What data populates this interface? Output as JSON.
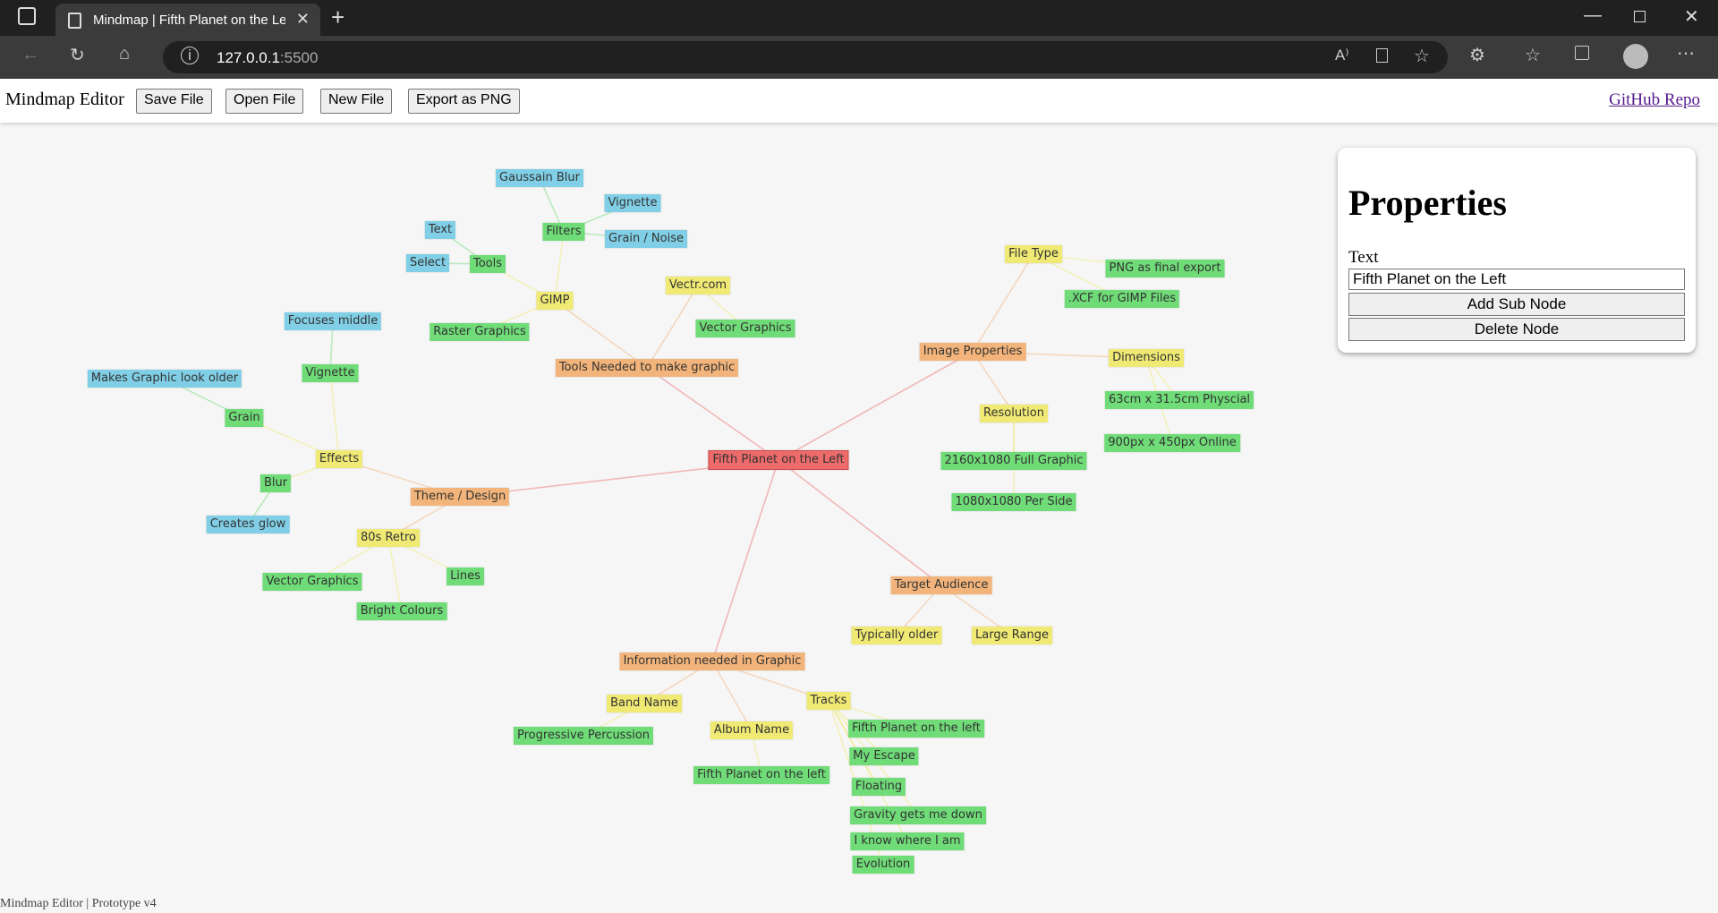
{
  "browser": {
    "tab_title": "Mindmap | Fifth Planet on the Left",
    "url_host": "127.0.0.1",
    "url_port": ":5500"
  },
  "toolbar": {
    "app_title": "Mindmap Editor",
    "save_label": "Save File",
    "open_label": "Open File",
    "new_label": "New File",
    "export_label": "Export as PNG",
    "github_label": "GitHub Repo"
  },
  "properties": {
    "heading": "Properties",
    "text_label": "Text",
    "text_value": "Fifth Planet on the Left",
    "add_label": "Add Sub Node",
    "delete_label": "Delete Node"
  },
  "footer": "Mindmap Editor | Prototype v4",
  "colors": {
    "root": "#ee6b6b",
    "level1": "#f2b47a",
    "level2": "#f0ea74",
    "level3": "#6fdc78",
    "level4": "#80cfe6"
  },
  "nodes": [
    {
      "id": "root",
      "label": "Fifth Planet on the Left",
      "level": 0,
      "parent": null
    },
    {
      "id": "tools",
      "label": "Tools Needed to make graphic",
      "level": 1,
      "parent": "root"
    },
    {
      "id": "gimp",
      "label": "GIMP",
      "level": 2,
      "parent": "tools"
    },
    {
      "id": "filters",
      "label": "Filters",
      "level": 3,
      "parent": "gimp"
    },
    {
      "id": "gauss",
      "label": "Gaussain Blur",
      "level": 4,
      "parent": "filters"
    },
    {
      "id": "vign1",
      "label": "Vignette",
      "level": 4,
      "parent": "filters"
    },
    {
      "id": "grain1",
      "label": "Grain / Noise",
      "level": 4,
      "parent": "filters"
    },
    {
      "id": "gtools",
      "label": "Tools",
      "level": 3,
      "parent": "gimp"
    },
    {
      "id": "text",
      "label": "Text",
      "level": 4,
      "parent": "gtools"
    },
    {
      "id": "select",
      "label": "Select",
      "level": 4,
      "parent": "gtools"
    },
    {
      "id": "raster",
      "label": "Raster Graphics",
      "level": 3,
      "parent": "gimp"
    },
    {
      "id": "vectr",
      "label": "Vectr.com",
      "level": 2,
      "parent": "tools"
    },
    {
      "id": "vecg1",
      "label": "Vector Graphics",
      "level": 3,
      "parent": "vectr"
    },
    {
      "id": "image",
      "label": "Image Properties",
      "level": 1,
      "parent": "root"
    },
    {
      "id": "ftype",
      "label": "File Type",
      "level": 2,
      "parent": "image"
    },
    {
      "id": "png",
      "label": "PNG as final export",
      "level": 3,
      "parent": "ftype"
    },
    {
      "id": "xcf",
      "label": ".XCF for GIMP Files",
      "level": 3,
      "parent": "ftype"
    },
    {
      "id": "dims",
      "label": "Dimensions",
      "level": 2,
      "parent": "image"
    },
    {
      "id": "d63",
      "label": "63cm x 31.5cm Physcial",
      "level": 3,
      "parent": "dims"
    },
    {
      "id": "d900",
      "label": "900px x 450px Online",
      "level": 3,
      "parent": "dims"
    },
    {
      "id": "res",
      "label": "Resolution",
      "level": 2,
      "parent": "image"
    },
    {
      "id": "r2160",
      "label": "2160x1080 Full Graphic",
      "level": 3,
      "parent": "res"
    },
    {
      "id": "r1080",
      "label": "1080x1080 Per Side",
      "level": 3,
      "parent": "res"
    },
    {
      "id": "theme",
      "label": "Theme / Design",
      "level": 1,
      "parent": "root"
    },
    {
      "id": "effects",
      "label": "Effects",
      "level": 2,
      "parent": "theme"
    },
    {
      "id": "vign2",
      "label": "Vignette",
      "level": 3,
      "parent": "effects"
    },
    {
      "id": "focus",
      "label": "Focuses middle",
      "level": 4,
      "parent": "vign2"
    },
    {
      "id": "grain2",
      "label": "Grain",
      "level": 3,
      "parent": "effects"
    },
    {
      "id": "older",
      "label": "Makes Graphic look older",
      "level": 4,
      "parent": "grain2"
    },
    {
      "id": "blur",
      "label": "Blur",
      "level": 3,
      "parent": "effects"
    },
    {
      "id": "glow",
      "label": "Creates glow",
      "level": 4,
      "parent": "blur"
    },
    {
      "id": "retro",
      "label": "80s Retro",
      "level": 2,
      "parent": "theme"
    },
    {
      "id": "vecg2",
      "label": "Vector Graphics",
      "level": 3,
      "parent": "retro"
    },
    {
      "id": "lines",
      "label": "Lines",
      "level": 3,
      "parent": "retro"
    },
    {
      "id": "bright",
      "label": "Bright Colours",
      "level": 3,
      "parent": "retro"
    },
    {
      "id": "target",
      "label": "Target Audience",
      "level": 1,
      "parent": "root"
    },
    {
      "id": "typ",
      "label": "Typically older",
      "level": 2,
      "parent": "target"
    },
    {
      "id": "large",
      "label": "Large Range",
      "level": 2,
      "parent": "target"
    },
    {
      "id": "info",
      "label": "Information needed in Graphic",
      "level": 1,
      "parent": "root"
    },
    {
      "id": "band",
      "label": "Band Name",
      "level": 2,
      "parent": "info"
    },
    {
      "id": "prog",
      "label": "Progressive Percussion",
      "level": 3,
      "parent": "band"
    },
    {
      "id": "album",
      "label": "Album Name",
      "level": 2,
      "parent": "info"
    },
    {
      "id": "fpl",
      "label": "Fifth Planet on the left",
      "level": 3,
      "parent": "album"
    },
    {
      "id": "tracks",
      "label": "Tracks",
      "level": 2,
      "parent": "info"
    },
    {
      "id": "t1",
      "label": "Fifth Planet on the left",
      "level": 3,
      "parent": "tracks"
    },
    {
      "id": "t2",
      "label": "My Escape",
      "level": 3,
      "parent": "tracks"
    },
    {
      "id": "t3",
      "label": "Floating",
      "level": 3,
      "parent": "tracks"
    },
    {
      "id": "t4",
      "label": "Gravity gets me down",
      "level": 3,
      "parent": "tracks"
    },
    {
      "id": "t5",
      "label": "I know where I am",
      "level": 3,
      "parent": "tracks"
    },
    {
      "id": "t6",
      "label": "Evolution",
      "level": 3,
      "parent": "tracks"
    }
  ]
}
